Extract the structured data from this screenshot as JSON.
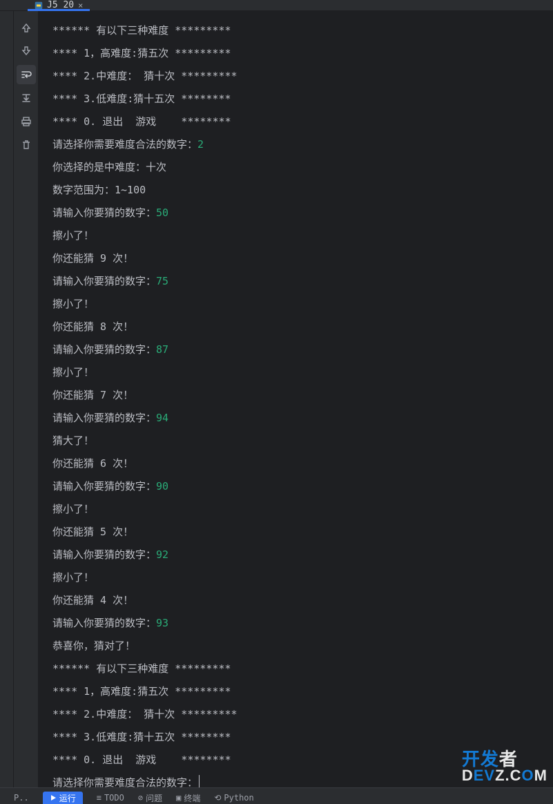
{
  "tab": {
    "label": "J5_20",
    "close_glyph": "×"
  },
  "numeric_color": "#2aac78",
  "toolbar_icons": [
    "arrow-up",
    "arrow-down",
    "wrap",
    "scroll-to-end",
    "print",
    "delete"
  ],
  "lines": [
    {
      "segs": [
        {
          "t": "****** 有以下三种难度 *********"
        }
      ]
    },
    {
      "segs": [
        {
          "t": "**** 1，高难度:猜五次 *********"
        }
      ]
    },
    {
      "segs": [
        {
          "t": "**** 2.中难度： 猜十次 *********"
        }
      ]
    },
    {
      "segs": [
        {
          "t": "**** 3.低难度:猜十五次 ********"
        }
      ]
    },
    {
      "segs": [
        {
          "t": "**** 0. 退出  游戏    ********"
        }
      ]
    },
    {
      "segs": [
        {
          "t": "请选择你需要难度合法的数字："
        },
        {
          "t": "2",
          "n": true
        }
      ]
    },
    {
      "segs": [
        {
          "t": "你选择的是中难度：十次"
        }
      ]
    },
    {
      "segs": [
        {
          "t": "数字范围为：1~100"
        }
      ]
    },
    {
      "segs": [
        {
          "t": "请输入你要猜的数字："
        },
        {
          "t": "50",
          "n": true
        }
      ]
    },
    {
      "segs": [
        {
          "t": "擦小了！"
        }
      ]
    },
    {
      "segs": [
        {
          "t": "你还能猜 9 次！"
        }
      ]
    },
    {
      "segs": [
        {
          "t": "请输入你要猜的数字："
        },
        {
          "t": "75",
          "n": true
        }
      ]
    },
    {
      "segs": [
        {
          "t": "擦小了！"
        }
      ]
    },
    {
      "segs": [
        {
          "t": "你还能猜 8 次！"
        }
      ]
    },
    {
      "segs": [
        {
          "t": "请输入你要猜的数字："
        },
        {
          "t": "87",
          "n": true
        }
      ]
    },
    {
      "segs": [
        {
          "t": "擦小了！"
        }
      ]
    },
    {
      "segs": [
        {
          "t": "你还能猜 7 次！"
        }
      ]
    },
    {
      "segs": [
        {
          "t": "请输入你要猜的数字："
        },
        {
          "t": "94",
          "n": true
        }
      ]
    },
    {
      "segs": [
        {
          "t": "猜大了！"
        }
      ]
    },
    {
      "segs": [
        {
          "t": "你还能猜 6 次！"
        }
      ]
    },
    {
      "segs": [
        {
          "t": "请输入你要猜的数字："
        },
        {
          "t": "90",
          "n": true
        }
      ]
    },
    {
      "segs": [
        {
          "t": "擦小了！"
        }
      ]
    },
    {
      "segs": [
        {
          "t": "你还能猜 5 次！"
        }
      ]
    },
    {
      "segs": [
        {
          "t": "请输入你要猜的数字："
        },
        {
          "t": "92",
          "n": true
        }
      ]
    },
    {
      "segs": [
        {
          "t": "擦小了！"
        }
      ]
    },
    {
      "segs": [
        {
          "t": "你还能猜 4 次！"
        }
      ]
    },
    {
      "segs": [
        {
          "t": "请输入你要猜的数字："
        },
        {
          "t": "93",
          "n": true
        }
      ]
    },
    {
      "segs": [
        {
          "t": "恭喜你，猜对了！"
        }
      ]
    },
    {
      "segs": [
        {
          "t": "****** 有以下三种难度 *********"
        }
      ]
    },
    {
      "segs": [
        {
          "t": "**** 1，高难度:猜五次 *********"
        }
      ]
    },
    {
      "segs": [
        {
          "t": "**** 2.中难度： 猜十次 *********"
        }
      ]
    },
    {
      "segs": [
        {
          "t": "**** 3.低难度:猜十五次 ********"
        }
      ]
    },
    {
      "segs": [
        {
          "t": "**** 0. 退出  游戏    ********"
        }
      ]
    },
    {
      "segs": [
        {
          "t": "请选择你需要难度合法的数字："
        }
      ],
      "caret": true
    }
  ],
  "watermark": {
    "line1_a": "开发",
    "line1_b": "者",
    "line2_a": "D",
    "line2_b": "EV",
    "line2_c": "Z.C",
    "line2_d": "O",
    "line2_e": "M"
  },
  "bottom": {
    "run": "运行",
    "todo": "TODO",
    "problems": "问题",
    "terminal": "终端",
    "python": "Python"
  }
}
